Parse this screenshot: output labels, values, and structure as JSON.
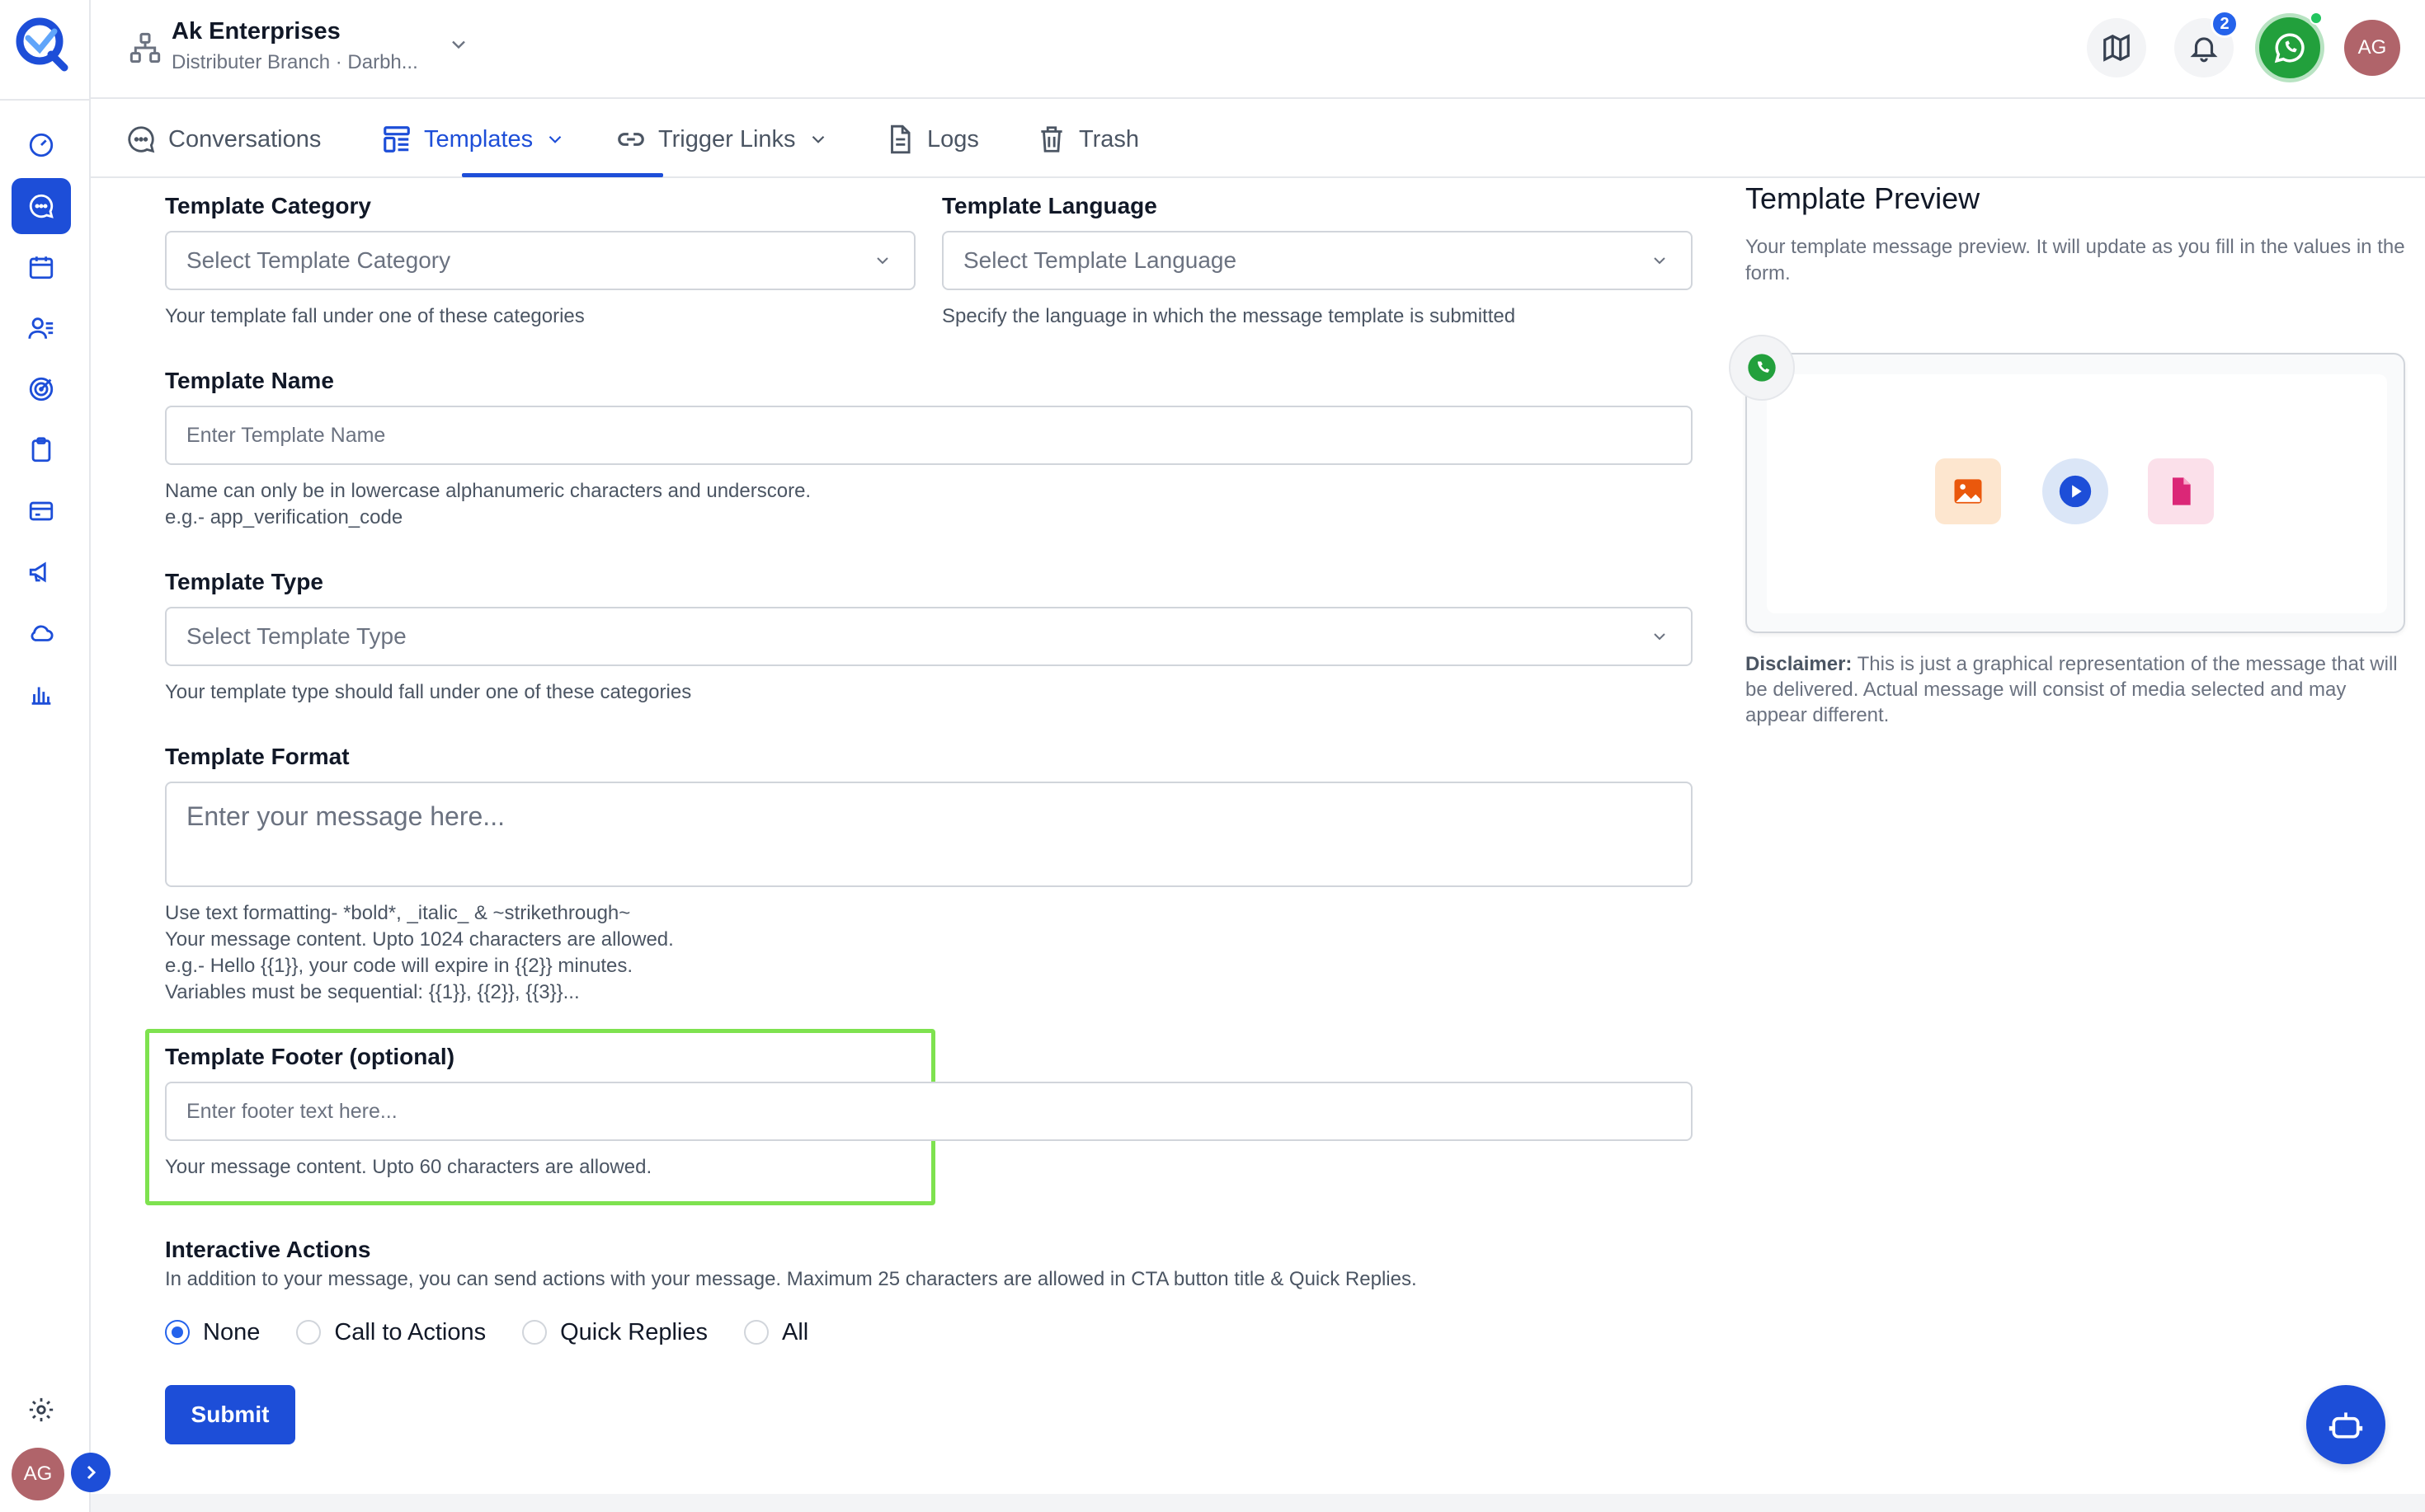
{
  "org": {
    "name": "Ak Enterprises",
    "sub": "Distributer Branch · Darbh..."
  },
  "header": {
    "notification_count": "2",
    "avatar_initials": "AG"
  },
  "rail": {
    "avatar_initials": "AG"
  },
  "tabs": [
    {
      "label": "Conversations"
    },
    {
      "label": "Templates"
    },
    {
      "label": "Trigger Links"
    },
    {
      "label": "Logs"
    },
    {
      "label": "Trash"
    }
  ],
  "form": {
    "category": {
      "label": "Template Category",
      "placeholder": "Select Template Category",
      "help": "Your template fall under one of these categories"
    },
    "language": {
      "label": "Template Language",
      "placeholder": "Select Template Language",
      "help": "Specify the language in which the message template is submitted"
    },
    "name": {
      "label": "Template Name",
      "placeholder": "Enter Template Name",
      "help1": "Name can only be in lowercase alphanumeric characters and underscore.",
      "help2": "e.g.- app_verification_code"
    },
    "type": {
      "label": "Template Type",
      "placeholder": "Select Template Type",
      "help": "Your template type should fall under one of these categories"
    },
    "format": {
      "label": "Template Format",
      "placeholder": "Enter your message here...",
      "help1": "Use text formatting- *bold*, _italic_ & ~strikethrough~",
      "help2": "Your message content. Upto 1024 characters are allowed.",
      "help3": "e.g.- Hello {{1}}, your code will expire in {{2}} minutes.",
      "help4": "Variables must be sequential: {{1}}, {{2}}, {{3}}..."
    },
    "footer": {
      "label": "Template Footer (optional)",
      "placeholder": "Enter footer text here...",
      "help": "Your message content. Upto 60 characters are allowed."
    },
    "actions": {
      "label": "Interactive Actions",
      "help": "In addition to your message, you can send actions with your message. Maximum 25 characters are allowed in CTA button title & Quick Replies.",
      "options": [
        {
          "label": "None",
          "selected": true
        },
        {
          "label": "Call to Actions",
          "selected": false
        },
        {
          "label": "Quick Replies",
          "selected": false
        },
        {
          "label": "All",
          "selected": false
        }
      ]
    },
    "submit": "Submit"
  },
  "preview": {
    "title": "Template Preview",
    "sub": "Your template message preview. It will update as you fill in the values in the form.",
    "disclaimer_label": "Disclaimer:",
    "disclaimer_text": " This is just a graphical representation of the message that will be delivered. Actual message will consist of media selected and may appear different."
  },
  "colors": {
    "primary": "#1d4ed8",
    "whatsapp": "#22a03c",
    "highlight": "#7ee24f"
  }
}
